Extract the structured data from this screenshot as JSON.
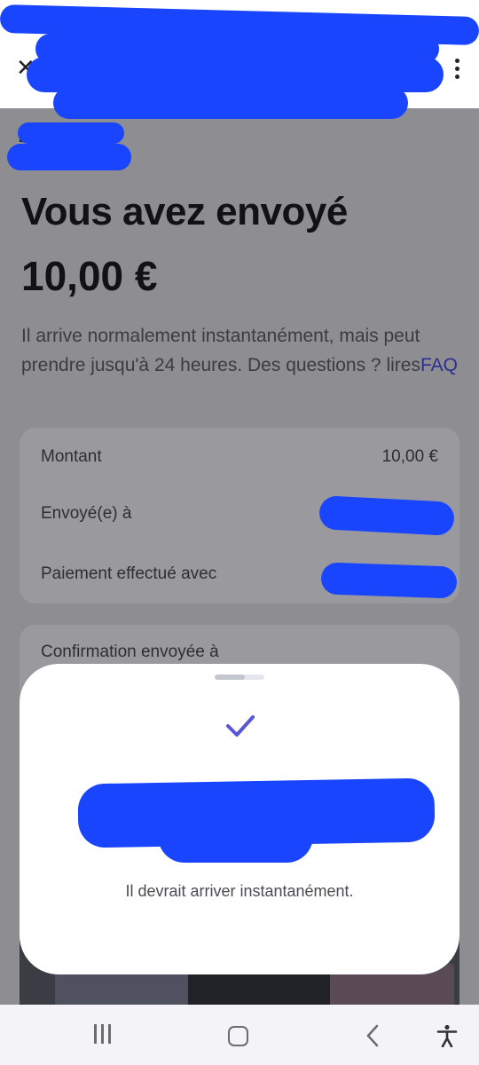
{
  "header": {
    "close_icon": "close-icon",
    "menu_icon": "more-vert-icon"
  },
  "main": {
    "title": "Vous avez envoyé",
    "amount": "10,00 €",
    "description": "Il arrive normalement instantanément, mais peut prendre jusqu'à 24 heures. Des questions ? lires",
    "faq_link": "FAQ"
  },
  "details": {
    "rows": [
      {
        "label": "Montant",
        "value": "10,00 €"
      },
      {
        "label": "Envoyé(e) à",
        "value": ""
      },
      {
        "label": "Paiement effectué avec",
        "value": ""
      }
    ]
  },
  "confirmation": {
    "label": "Confirmation envoyée à"
  },
  "sheet": {
    "icon": "check-icon",
    "message": "Il devrait arriver instantanément."
  },
  "navbar": {
    "items": [
      "recents-icon",
      "home-icon",
      "back-icon",
      "accessibility-icon"
    ]
  },
  "colors": {
    "redaction": "#1a45ff",
    "accent": "#5856d6",
    "link": "#2b2f8f"
  }
}
